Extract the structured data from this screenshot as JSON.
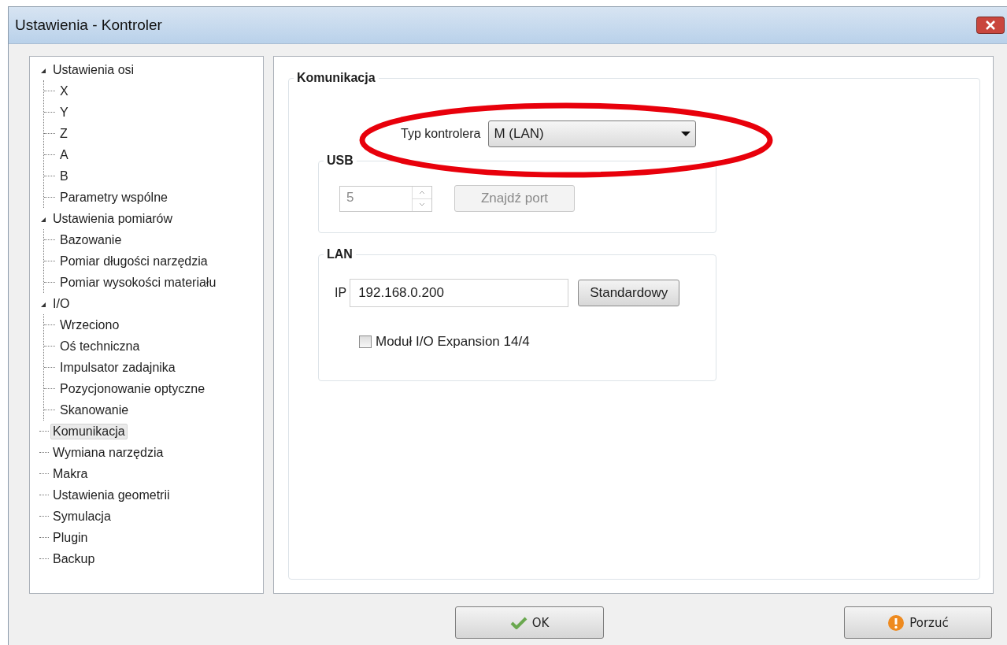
{
  "window": {
    "title": "Ustawienia - Kontroler"
  },
  "tree": [
    {
      "label": "Ustawienia osi",
      "expanded": true,
      "selected": false,
      "children": [
        {
          "label": "X",
          "selected": false
        },
        {
          "label": "Y",
          "selected": false
        },
        {
          "label": "Z",
          "selected": false
        },
        {
          "label": "A",
          "selected": false
        },
        {
          "label": "B",
          "selected": false
        },
        {
          "label": "Parametry wspólne",
          "selected": false
        }
      ]
    },
    {
      "label": "Ustawienia pomiarów",
      "expanded": true,
      "selected": false,
      "children": [
        {
          "label": "Bazowanie",
          "selected": false
        },
        {
          "label": "Pomiar długości narzędzia",
          "selected": false
        },
        {
          "label": "Pomiar wysokości materiału",
          "selected": false
        }
      ]
    },
    {
      "label": "I/O",
      "expanded": true,
      "selected": false,
      "children": [
        {
          "label": "Wrzeciono",
          "selected": false
        },
        {
          "label": "Oś techniczna",
          "selected": false
        },
        {
          "label": "Impulsator zadajnika",
          "selected": false
        },
        {
          "label": "Pozycjonowanie optyczne",
          "selected": false
        },
        {
          "label": "Skanowanie",
          "selected": false
        }
      ]
    },
    {
      "label": "Komunikacja",
      "selected": true
    },
    {
      "label": "Wymiana narzędzia",
      "selected": false
    },
    {
      "label": "Makra",
      "selected": false
    },
    {
      "label": "Ustawienia geometrii",
      "selected": false
    },
    {
      "label": "Symulacja",
      "selected": false
    },
    {
      "label": "Plugin",
      "selected": false
    },
    {
      "label": "Backup",
      "selected": false
    }
  ],
  "panel": {
    "title": "Komunikacja",
    "controller_type": {
      "label": "Typ kontrolera",
      "value": "M (LAN)"
    },
    "usb": {
      "title": "USB",
      "port": {
        "value": "5",
        "disabled": true
      },
      "find_button": {
        "label": "Znajdź port",
        "disabled": true
      }
    },
    "lan": {
      "title": "LAN",
      "ip_label": "IP",
      "ip": {
        "value": "192.168.0.200"
      },
      "default_button": {
        "label": "Standardowy"
      },
      "expansion": {
        "label": "Moduł I/O Expansion 14/4",
        "checked": false
      }
    }
  },
  "buttons": [
    {
      "label": "OK",
      "kind": "ok"
    },
    {
      "label": "Porzuć",
      "kind": "cancel"
    }
  ]
}
